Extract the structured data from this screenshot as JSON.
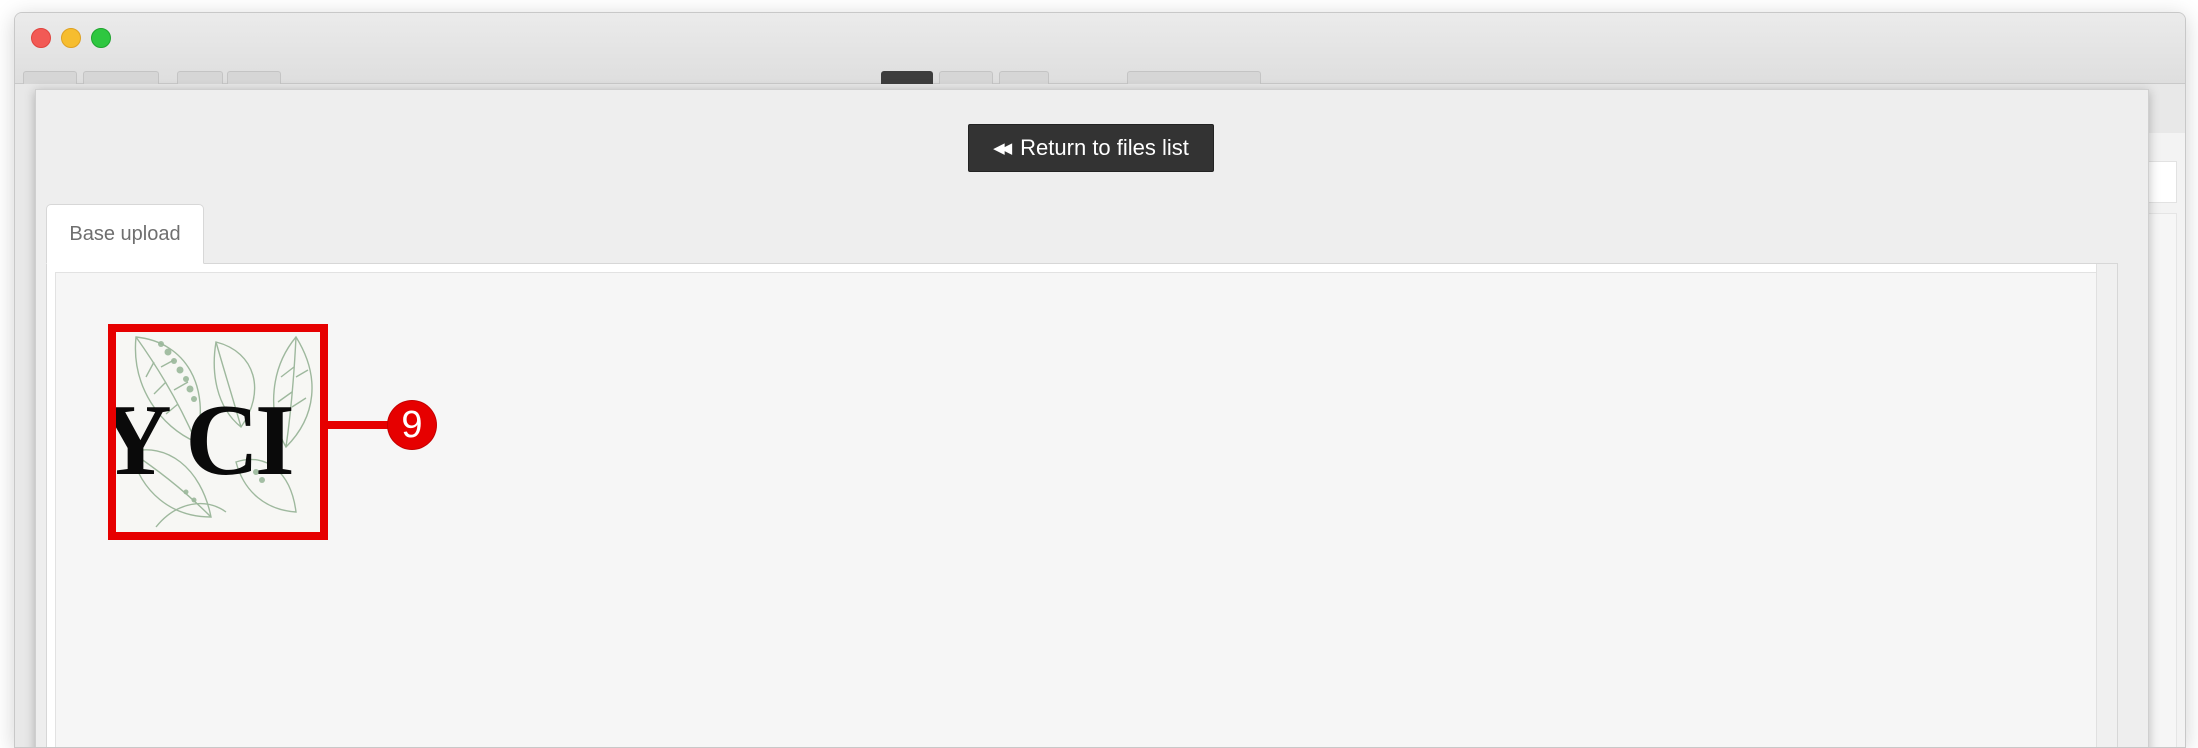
{
  "modal": {
    "return_button": {
      "icon": "fast-backward-icon",
      "label": "Return to files list"
    },
    "tabs": [
      {
        "label": "Base upload",
        "active": true
      }
    ],
    "thumbnail": {
      "logo_text": "Y CI",
      "annotation_marker": "9"
    }
  },
  "colors": {
    "annotation_red": "#e60000",
    "button_dark": "#333333",
    "leaf_green": "#8fae8f"
  }
}
